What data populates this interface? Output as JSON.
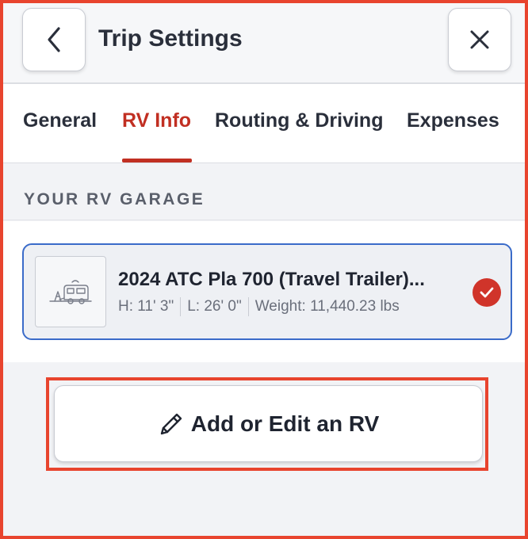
{
  "header": {
    "title": "Trip Settings",
    "back_icon": "chevron-left-icon",
    "close_icon": "close-icon"
  },
  "tabs": [
    {
      "label": "General",
      "active": false
    },
    {
      "label": "RV Info",
      "active": true
    },
    {
      "label": "Routing & Driving",
      "active": false
    },
    {
      "label": "Expenses",
      "active": false
    }
  ],
  "garage": {
    "section_label": "YOUR RV GARAGE",
    "rvs": [
      {
        "name": "2024 ATC Pla 700 (Travel Trailer)...",
        "height": "H: 11' 3\"",
        "length": "L: 26' 0\"",
        "weight": "Weight: 11,440.23 lbs",
        "selected": true,
        "thumbnail_icon": "travel-trailer-icon"
      }
    ]
  },
  "actions": {
    "add_edit_label": "Add or Edit an RV",
    "add_edit_icon": "pencil-icon"
  },
  "colors": {
    "accent": "#c12f22",
    "selected_border": "#3a6bc9",
    "highlight_frame": "#e8442e"
  }
}
